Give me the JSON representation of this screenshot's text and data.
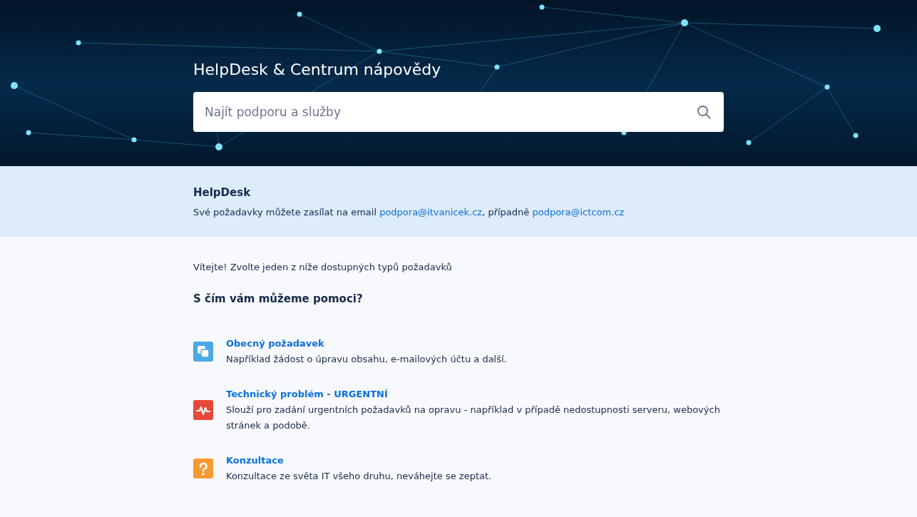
{
  "hero": {
    "title": "HelpDesk & Centrum nápovědy",
    "search": {
      "placeholder": "Najít podporu a služby"
    }
  },
  "notice": {
    "title": "HelpDesk",
    "text": "Své požadavky můžete zasílat na email ",
    "email_1": "podpora@itvanicek.cz",
    "joiner": ", případně ",
    "email_2": "podpora@ictcom.cz"
  },
  "welcome": "Vítejte! Zvolte jeden z níže dostupných typů požadavků",
  "heading": "S čím vám můžeme pomoci?",
  "request_types": [
    {
      "kind": "copy",
      "color": "#4aa8e6",
      "title": "Obecný požadavek",
      "description": "Například žádost o úpravu obsahu, e-mailových účtu a další."
    },
    {
      "kind": "pulse",
      "color": "#e8473b",
      "title": "Technický problém - URGENTNÍ",
      "description": "Slouží pro zadání urgentních požadavků na opravu - například v případě nedostupnosti serveru, webových stránek a podobě."
    },
    {
      "kind": "question",
      "color": "#f89a32",
      "title": "Konzultace",
      "description": "Konzultace ze světa IT všeho druhu, neváhejte se zeptat."
    }
  ]
}
